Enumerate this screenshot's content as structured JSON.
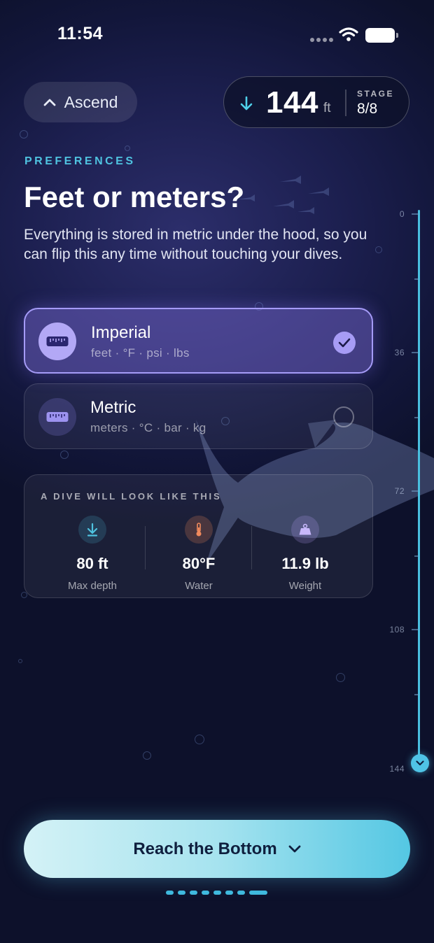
{
  "status_bar": {
    "time": "11:54"
  },
  "header": {
    "ascend_label": "Ascend",
    "depth_value": "144",
    "depth_unit": "ft",
    "stage_label": "STAGE",
    "stage_value": "8/8"
  },
  "content": {
    "eyebrow": "PREFERENCES",
    "title": "Feet or meters?",
    "description": "Everything is stored in metric under the hood, so you can flip this any time without touching your dives."
  },
  "options": [
    {
      "title": "Imperial",
      "subtitle": "feet · °F · psi · lbs",
      "selected": true,
      "icon": "ruler-icon"
    },
    {
      "title": "Metric",
      "subtitle": "meters · °C · bar · kg",
      "selected": false,
      "icon": "ruler-icon"
    }
  ],
  "preview": {
    "label": "A DIVE WILL LOOK LIKE THIS",
    "stats": [
      {
        "value": "80 ft",
        "label": "Max depth",
        "icon": "arrow-down-icon",
        "color": "#4fc3e0"
      },
      {
        "value": "80°F",
        "label": "Water",
        "icon": "thermometer-icon",
        "color": "#f08a5d"
      },
      {
        "value": "11.9 lb",
        "label": "Weight",
        "icon": "weight-icon",
        "color": "#b29cf7"
      }
    ]
  },
  "gauge": {
    "labels": [
      "0",
      "36",
      "72",
      "108",
      "144"
    ],
    "current_depth": 144,
    "max_depth": 144
  },
  "cta": {
    "label": "Reach the Bottom"
  },
  "pager": {
    "count": 8,
    "active_index": 7
  },
  "colors": {
    "accent": "#4fc3e0",
    "selected": "#a59bf7",
    "background": "#161a45"
  }
}
